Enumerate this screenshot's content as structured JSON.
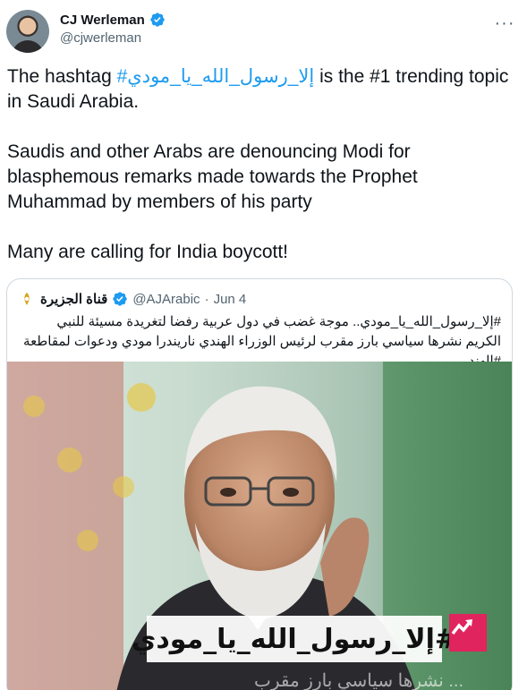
{
  "author": {
    "display_name": "CJ Werleman",
    "handle": "@cjwerleman",
    "verified": true,
    "avatar_icon": "avatar-photo"
  },
  "more_menu": {
    "label": "···",
    "icon": "more-horizontal-icon"
  },
  "tweet_text": {
    "line1_prefix": "The hashtag ",
    "hashtag": "#إلا_رسول_الله_يا_مودي",
    "line1_suffix": " is the #1 trending topic in Saudi Arabia.",
    "para2": "Saudis and other Arabs are denouncing Modi for blasphemous remarks made towards the Prophet Muhammad by members of his party",
    "para3": "Many are calling for India boycott!"
  },
  "quoted_tweet": {
    "display_name": "قناة الجزيرة",
    "handle": "@AJArabic",
    "separator": "·",
    "date": "Jun 4",
    "verified": true,
    "avatar_icon": "al-jazeera-logo-icon",
    "text": "#إلا_رسول_الله_يا_مودي.. موجة غضب في دول عربية رفضا لتغريدة مسيئة للنبي الكريم نشرها سياسي بارز مقرب لرئيس الوزراء الهندي ناريندرا مودي ودعوات لمقاطعة #الهند",
    "media": {
      "caption": "#إلا_رسول_الله_يا_مودي",
      "badge_icon": "trending-arrow-icon",
      "bottom_text": "... نشرها سياسي بارز مقرب"
    }
  },
  "colors": {
    "link": "#1d9bf0",
    "verified": "#1d9bf0",
    "secondary_text": "#536471",
    "border": "#cfd9de",
    "badge": "#e0245e"
  }
}
